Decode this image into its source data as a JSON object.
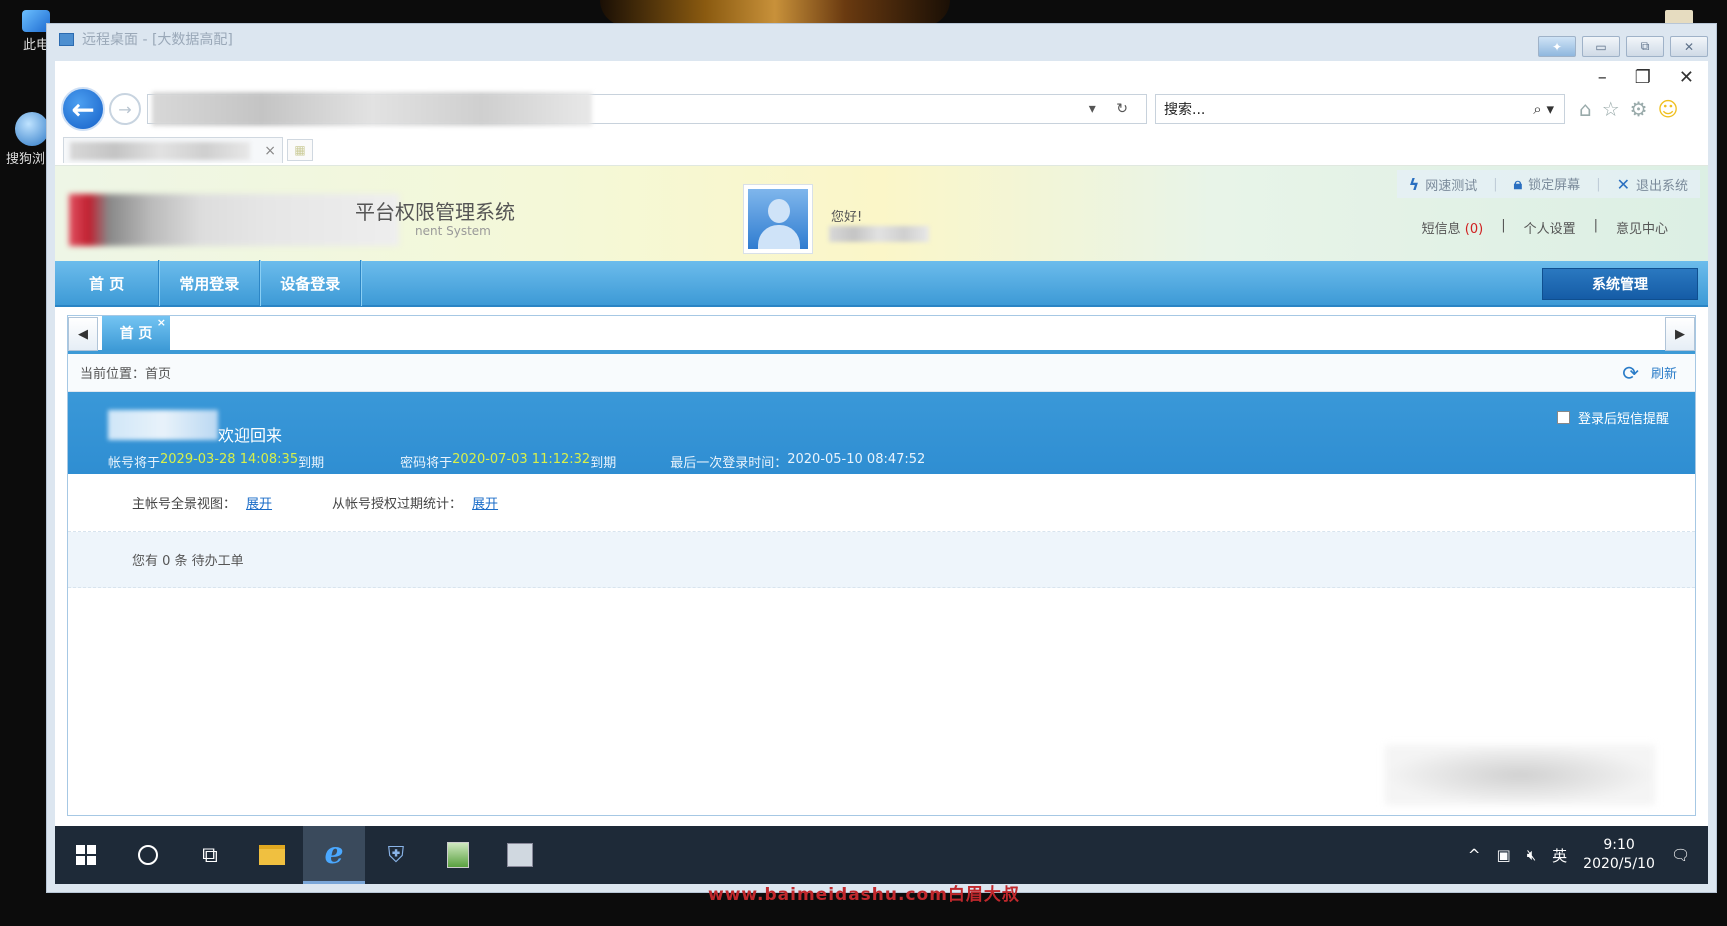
{
  "outer_window": {
    "title": "远程桌面 - [大数据高配]"
  },
  "desktop": {
    "icons": [
      {
        "label": "此电"
      },
      {
        "label": "搜狗浏览"
      }
    ]
  },
  "ie": {
    "window_controls": {
      "minimize": "–",
      "restore": "❐",
      "close": "✕"
    },
    "search_placeholder": "搜索...",
    "address_tools": "▾ ↻",
    "tab_close": "×"
  },
  "header": {
    "title": "平台权限管理系统",
    "subtitle": "nent System",
    "greeting": "您好!",
    "top_links": [
      {
        "icon": "lightning-icon",
        "label": "网速测试"
      },
      {
        "icon": "lock-icon",
        "label": "锁定屏幕"
      },
      {
        "icon": "close-icon",
        "label": "退出系统"
      }
    ],
    "user_links": {
      "sms_label": "短信息",
      "sms_count": "(0)",
      "settings": "个人设置",
      "feedback": "意见中心"
    }
  },
  "main_nav": {
    "items": [
      "首 页",
      "常用登录",
      "设备登录"
    ],
    "system_button": "系统管理"
  },
  "workspace": {
    "tab_label": "首 页",
    "breadcrumb": "当前位置：首页",
    "refresh_label": "刷新",
    "welcome": {
      "back_text": "欢迎回来",
      "account_expire_prefix": "帐号将于 ",
      "account_expire_date": "2029-03-28 14:08:35",
      "account_expire_suffix": " 到期",
      "password_expire_prefix": "密码将于 ",
      "password_expire_date": "2020-07-03 11:12:32",
      "password_expire_suffix": " 到期",
      "last_login_label": "最后一次登录时间：",
      "last_login_time": "2020-05-10 08:47:52",
      "sms_reminder": "登录后短信提醒"
    },
    "links": {
      "main_view_label": "主帐号全景视图：",
      "main_view_link": "展开",
      "expire_stats_label": "从帐号授权过期统计：",
      "expire_stats_link": "展开"
    },
    "todo": "您有 0 条 待办工单"
  },
  "taskbar": {
    "time": "9:10",
    "date": "2020/5/10",
    "ime": "英"
  },
  "watermark": "www.baimeidashu.com白眉大叔"
}
